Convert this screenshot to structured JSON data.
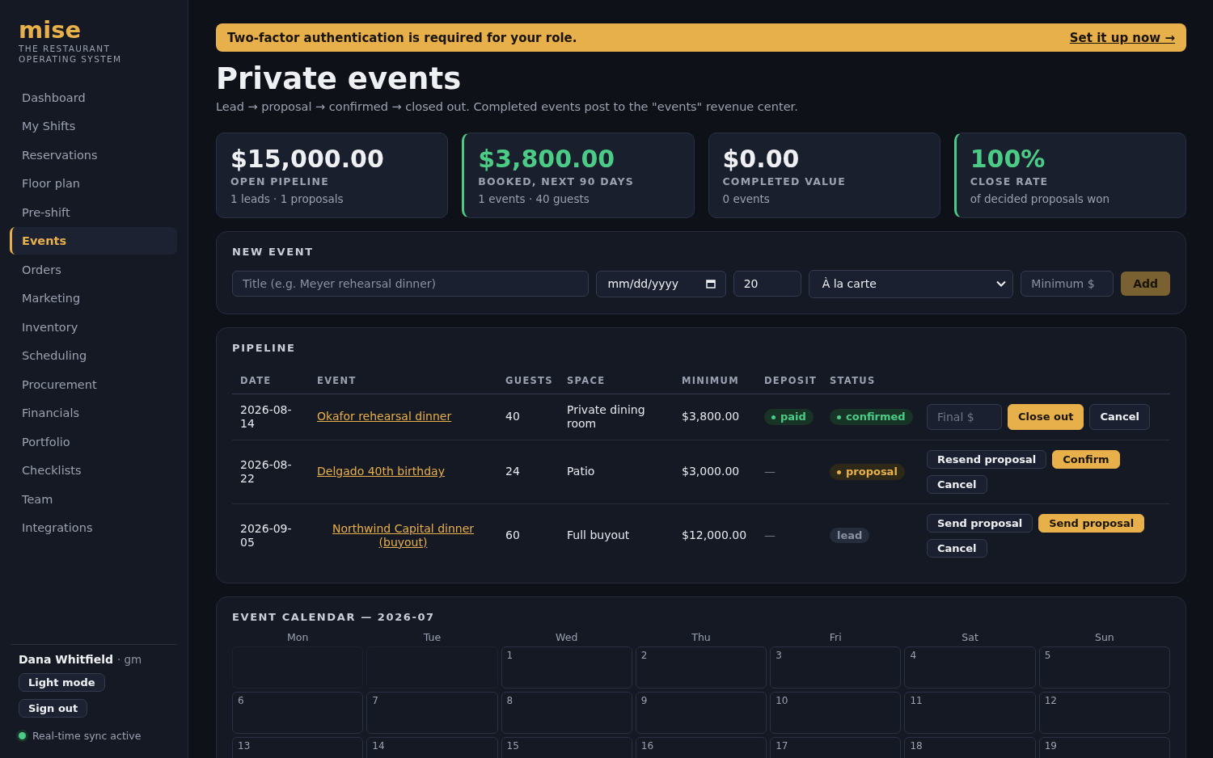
{
  "brand": {
    "name": "mise",
    "tagline": "THE RESTAURANT OPERATING SYSTEM"
  },
  "sidebar": {
    "items": [
      {
        "label": "Dashboard",
        "selected": false
      },
      {
        "label": "My Shifts",
        "selected": false
      },
      {
        "label": "Reservations",
        "selected": false
      },
      {
        "label": "Floor plan",
        "selected": false
      },
      {
        "label": "Pre-shift",
        "selected": false
      },
      {
        "label": "Events",
        "selected": true
      },
      {
        "label": "Orders",
        "selected": false
      },
      {
        "label": "Marketing",
        "selected": false
      },
      {
        "label": "Inventory",
        "selected": false
      },
      {
        "label": "Scheduling",
        "selected": false
      },
      {
        "label": "Procurement",
        "selected": false
      },
      {
        "label": "Financials",
        "selected": false
      },
      {
        "label": "Portfolio",
        "selected": false
      },
      {
        "label": "Checklists",
        "selected": false
      },
      {
        "label": "Team",
        "selected": false
      },
      {
        "label": "Integrations",
        "selected": false
      }
    ]
  },
  "user": {
    "name": "Dana Whitfield",
    "role": "· gm",
    "buttons": [
      "Light mode",
      "Sign out"
    ],
    "sync": "Real-time sync active"
  },
  "banner": {
    "text": "Two-factor authentication is required for your role.",
    "link": "Set it up now →"
  },
  "title": "Private events",
  "subtitle": "Lead → proposal → confirmed → closed out. Completed events post to the \"events\" revenue center.",
  "stats": [
    {
      "value": "$15,000.00",
      "label": "OPEN PIPELINE",
      "note": "1 leads · 1 proposals",
      "accent": false
    },
    {
      "value": "$3,800.00",
      "label": "BOOKED, NEXT 90 DAYS",
      "note": "1 events · 40 guests",
      "accent": true
    },
    {
      "value": "$0.00",
      "label": "COMPLETED VALUE",
      "note": "0 events",
      "accent": false
    },
    {
      "value": "100%",
      "label": "CLOSE RATE",
      "note": "of decided proposals won",
      "accent": true
    }
  ],
  "new_event": {
    "heading": "NEW EVENT",
    "title_placeholder": "Title (e.g. Meyer rehearsal dinner)",
    "date_value": "mm/dd/yyyy",
    "guests_value": "20",
    "space_value": "À la carte",
    "minimum_placeholder": "Minimum $",
    "add_button": "Add"
  },
  "pipeline": {
    "heading": "PIPELINE",
    "columns": [
      "DATE",
      "EVENT",
      "GUESTS",
      "SPACE",
      "MINIMUM",
      "DEPOSIT",
      "STATUS"
    ],
    "rows": [
      {
        "date": "2026-08-14",
        "event": "Okafor rehearsal dinner",
        "guests": "40",
        "space": "Private dining room",
        "minimum": "$3,800.00",
        "deposit": {
          "kind": "paid",
          "text": "paid"
        },
        "status": {
          "kind": "confirmed",
          "text": "confirmed"
        },
        "actions": [
          {
            "kind": "input",
            "placeholder": "Final $"
          },
          {
            "kind": "primary",
            "text": "Close out"
          },
          {
            "kind": "secondary",
            "text": "Cancel"
          }
        ]
      },
      {
        "date": "2026-08-22",
        "event": "Delgado 40th birthday",
        "guests": "24",
        "space": "Patio",
        "minimum": "$3,000.00",
        "deposit": {
          "kind": "none",
          "text": "—"
        },
        "status": {
          "kind": "proposal",
          "text": "proposal"
        },
        "actions": [
          {
            "kind": "secondary",
            "text": "Resend proposal"
          },
          {
            "kind": "primary",
            "text": "Confirm"
          },
          {
            "kind": "secondary",
            "text": "Cancel"
          }
        ]
      },
      {
        "date": "2026-09-05",
        "event": "Northwind Capital dinner (buyout)",
        "guests": "60",
        "space": "Full buyout",
        "minimum": "$12,000.00",
        "deposit": {
          "kind": "none",
          "text": "—"
        },
        "status": {
          "kind": "lead",
          "text": "lead"
        },
        "actions": [
          {
            "kind": "secondary",
            "text": "Send proposal"
          },
          {
            "kind": "primary",
            "text": "Send proposal"
          },
          {
            "kind": "secondary",
            "text": "Cancel"
          }
        ]
      }
    ]
  },
  "calendar": {
    "heading": "EVENT CALENDAR — 2026-07",
    "weekdays": [
      "Mon",
      "Tue",
      "Wed",
      "Thu",
      "Fri",
      "Sat",
      "Sun"
    ],
    "cells": [
      {
        "kind": "blank"
      },
      {
        "kind": "blank"
      },
      {
        "kind": "day",
        "label": "1"
      },
      {
        "kind": "day",
        "label": "2"
      },
      {
        "kind": "day",
        "label": "3"
      },
      {
        "kind": "day",
        "label": "4"
      },
      {
        "kind": "day",
        "label": "5"
      },
      {
        "kind": "day",
        "label": "6"
      },
      {
        "kind": "day",
        "label": "7"
      },
      {
        "kind": "day",
        "label": "8"
      },
      {
        "kind": "day",
        "label": "9"
      },
      {
        "kind": "day",
        "label": "10"
      },
      {
        "kind": "day",
        "label": "11"
      },
      {
        "kind": "day",
        "label": "12"
      },
      {
        "kind": "day",
        "label": "13"
      },
      {
        "kind": "day",
        "label": "14"
      },
      {
        "kind": "day",
        "label": "15"
      },
      {
        "kind": "day",
        "label": "16"
      },
      {
        "kind": "day",
        "label": "17"
      },
      {
        "kind": "day",
        "label": "18"
      },
      {
        "kind": "day",
        "label": "19"
      }
    ]
  }
}
